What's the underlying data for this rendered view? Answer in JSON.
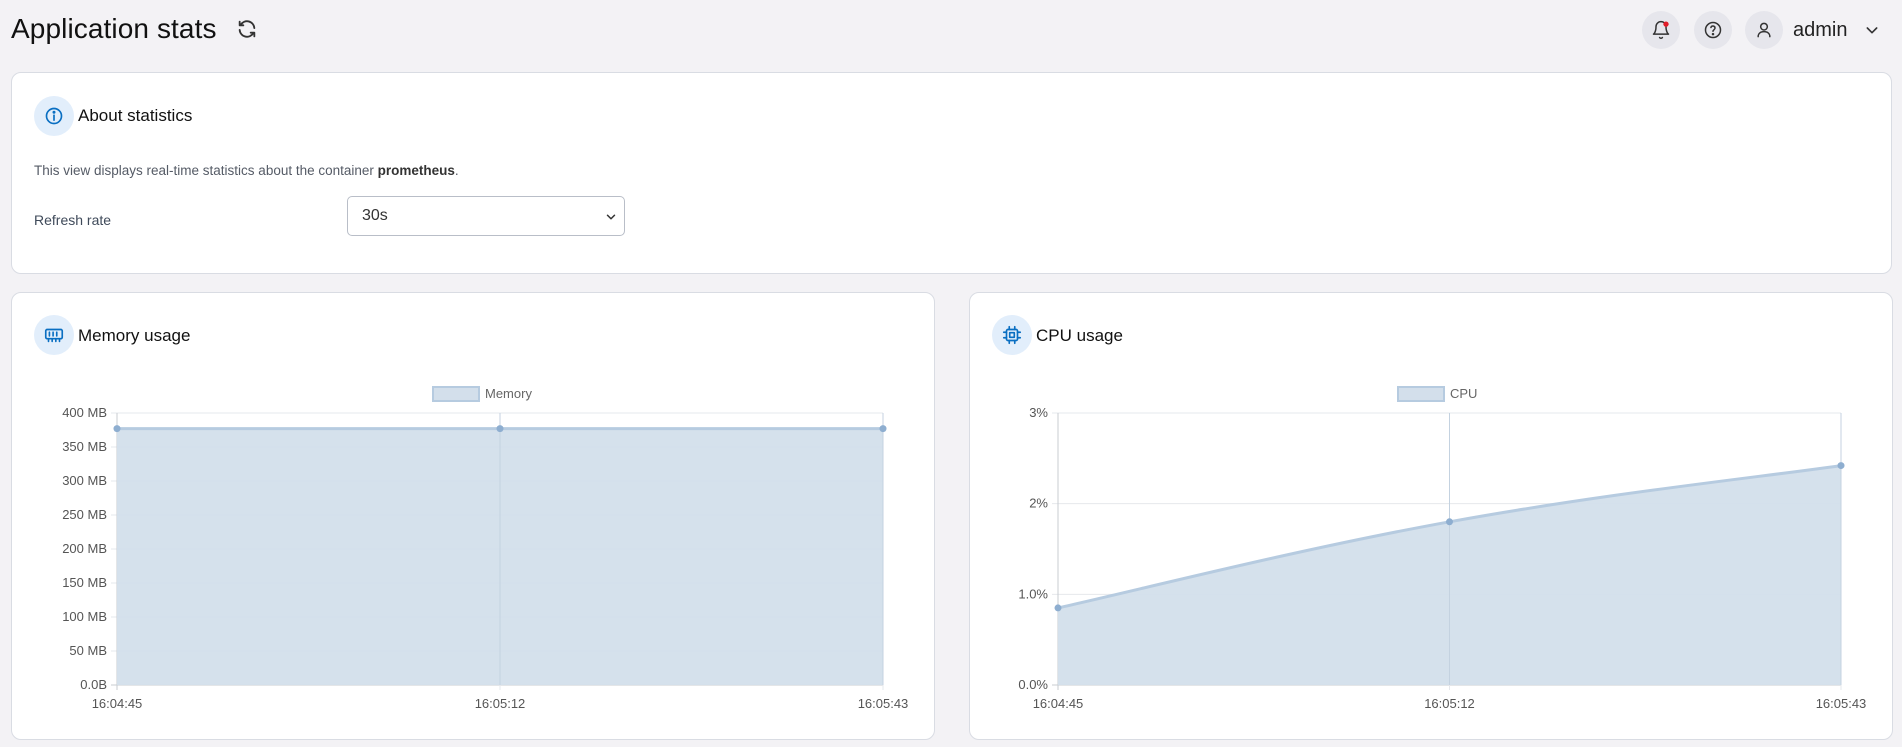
{
  "header": {
    "title": "Application stats",
    "user": "admin",
    "icons": [
      "refresh-icon",
      "bell-icon",
      "help-icon",
      "user-icon",
      "chevron-down-icon"
    ],
    "notification_dot_color": "#e11d2a"
  },
  "about": {
    "title": "About statistics",
    "text_prefix": "This view displays real-time statistics about the container ",
    "container": "prometheus",
    "text_suffix": ".",
    "refresh_label": "Refresh rate",
    "refresh_value": "30s"
  },
  "memory": {
    "title": "Memory usage"
  },
  "cpu": {
    "title": "CPU usage"
  },
  "colors": {
    "accent": "#0a6fc2",
    "series_fill": "#d3dfeb",
    "series_line": "#b6cbe0",
    "point": "#8eaed0"
  },
  "chart_data": [
    {
      "type": "area",
      "legend": [
        "Memory"
      ],
      "legend_position": "top-center",
      "x": [
        "16:04:45",
        "16:05:12",
        "16:05:43"
      ],
      "series": [
        {
          "name": "Memory",
          "values": [
            377,
            377,
            377
          ]
        }
      ],
      "ylim": [
        0,
        400
      ],
      "yticks": [
        0,
        50,
        100,
        150,
        200,
        250,
        300,
        350,
        400
      ],
      "ytick_labels": [
        "0.0B",
        "50 MB",
        "100 MB",
        "150 MB",
        "200 MB",
        "250 MB",
        "300 MB",
        "350 MB",
        "400 MB"
      ],
      "grid": true
    },
    {
      "type": "area",
      "legend": [
        "CPU"
      ],
      "legend_position": "top-center",
      "x": [
        "16:04:45",
        "16:05:12",
        "16:05:43"
      ],
      "series": [
        {
          "name": "CPU",
          "values": [
            0.85,
            1.8,
            2.42
          ]
        }
      ],
      "ylim": [
        0,
        3
      ],
      "yticks": [
        0,
        1,
        2,
        3
      ],
      "ytick_labels": [
        "0.0%",
        "1.0%",
        "2%",
        "3%"
      ],
      "grid": true
    }
  ]
}
